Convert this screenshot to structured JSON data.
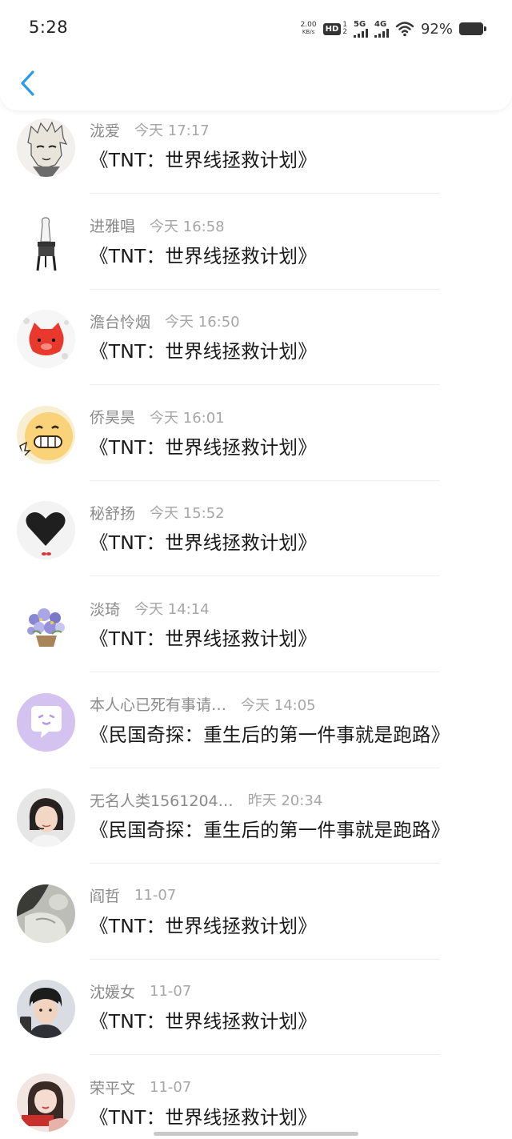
{
  "status_bar": {
    "time": "5:28",
    "net_speed_value": "2.00",
    "net_speed_unit": "KB/s",
    "hd_label": "HD",
    "hd_sub": "1\n2",
    "signal_1_label": "5G",
    "signal_2_label": "4G",
    "battery_percent": "92%"
  },
  "header": {
    "back_icon": "chevron-left-icon",
    "accent_color": "#2a9bea"
  },
  "items": [
    {
      "name": "泷爱",
      "time": "今天 17:17",
      "title": "《TNT：世界线拯救计划》",
      "avatar": "anime-man-avatar"
    },
    {
      "name": "进雅唱",
      "time": "今天 16:58",
      "title": "《TNT：世界线拯救计划》",
      "avatar": "chair-avatar"
    },
    {
      "name": "澹台怜烟",
      "time": "今天 16:50",
      "title": "《TNT：世界线拯救计划》",
      "avatar": "pig-avatar"
    },
    {
      "name": "侨昊昊",
      "time": "今天 16:01",
      "title": "《TNT：世界线拯救计划》",
      "avatar": "grin-face-avatar"
    },
    {
      "name": "秘舒扬",
      "time": "今天 15:52",
      "title": "《TNT：世界线拯救计划》",
      "avatar": "heart-avatar"
    },
    {
      "name": "淡琦",
      "time": "今天 14:14",
      "title": "《TNT：世界线拯救计划》",
      "avatar": "flowers-avatar"
    },
    {
      "name": "本人心已死有事请…",
      "time": "今天 14:05",
      "title": "《民国奇探：重生后的第一件事就是跑路》",
      "avatar": "chat-bubble-avatar"
    },
    {
      "name": "无名人类1561204…",
      "time": "昨天 20:34",
      "title": "《民国奇探：重生后的第一件事就是跑路》",
      "avatar": "headset-woman-avatar"
    },
    {
      "name": "阎哲",
      "time": "11-07",
      "title": "《TNT：世界线拯救计划》",
      "avatar": "bw-photo-avatar"
    },
    {
      "name": "沈媛女",
      "time": "11-07",
      "title": "《TNT：世界线拯救计划》",
      "avatar": "boy-photo-avatar"
    },
    {
      "name": "荣平文",
      "time": "11-07",
      "title": "《TNT：世界线拯救计划》",
      "avatar": "girl-photo-avatar"
    }
  ]
}
